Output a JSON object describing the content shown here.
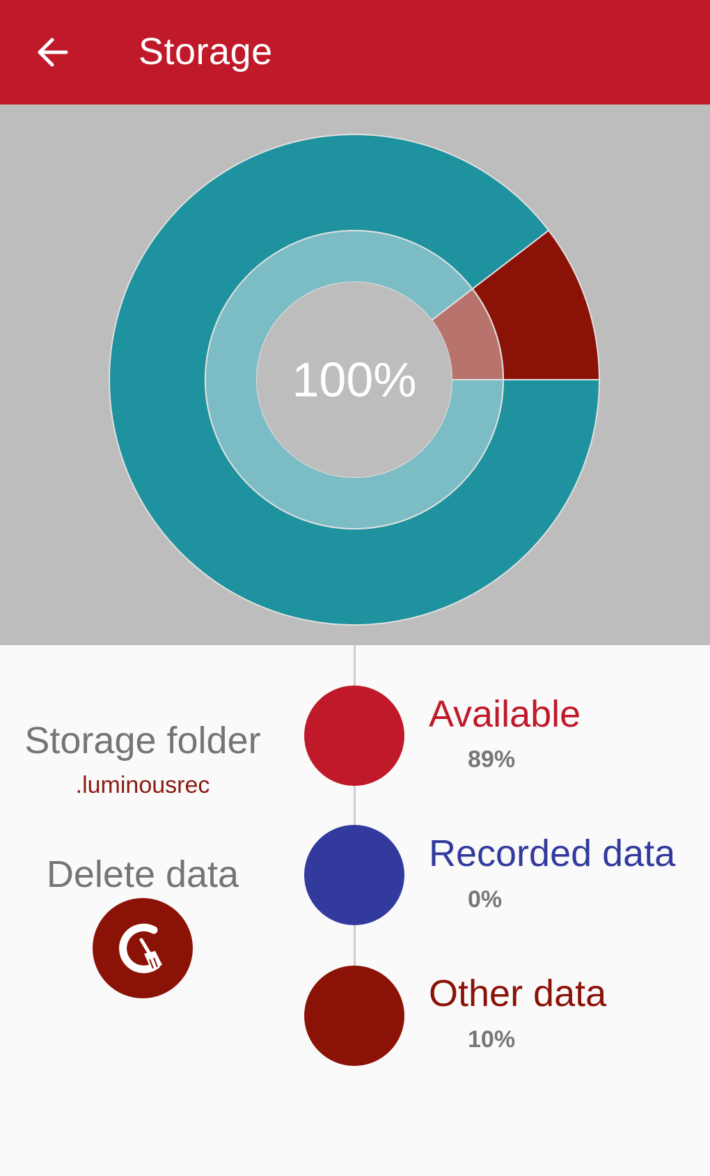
{
  "appbar": {
    "title": "Storage"
  },
  "colors": {
    "primary": "#c01a2a",
    "teal_outer": "#1e929e",
    "teal_inner": "#7bbcc5",
    "other": "#8b1207",
    "other_inner": "#b8736c",
    "recorded": "#333a9e",
    "chart_bg": "#bdbdbd"
  },
  "chart_data": {
    "type": "pie",
    "center_label": "100%",
    "categories": [
      "Available",
      "Recorded data",
      "Other data"
    ],
    "values": [
      89,
      0,
      10
    ],
    "colors": [
      "#1e929e",
      "#333a9e",
      "#8b1207"
    ]
  },
  "legend": [
    {
      "label": "Available",
      "value": "89%",
      "color": "#c01a2a"
    },
    {
      "label": "Recorded data",
      "value": "0%",
      "color": "#333a9e"
    },
    {
      "label": "Other data",
      "value": "10%",
      "color": "#8b1207"
    }
  ],
  "storage_folder": {
    "label": "Storage folder",
    "name": ".luminousrec"
  },
  "delete_data": {
    "label": "Delete data"
  },
  "icons": {
    "back": "arrow-left-icon",
    "clean": "broom-clean-icon"
  }
}
